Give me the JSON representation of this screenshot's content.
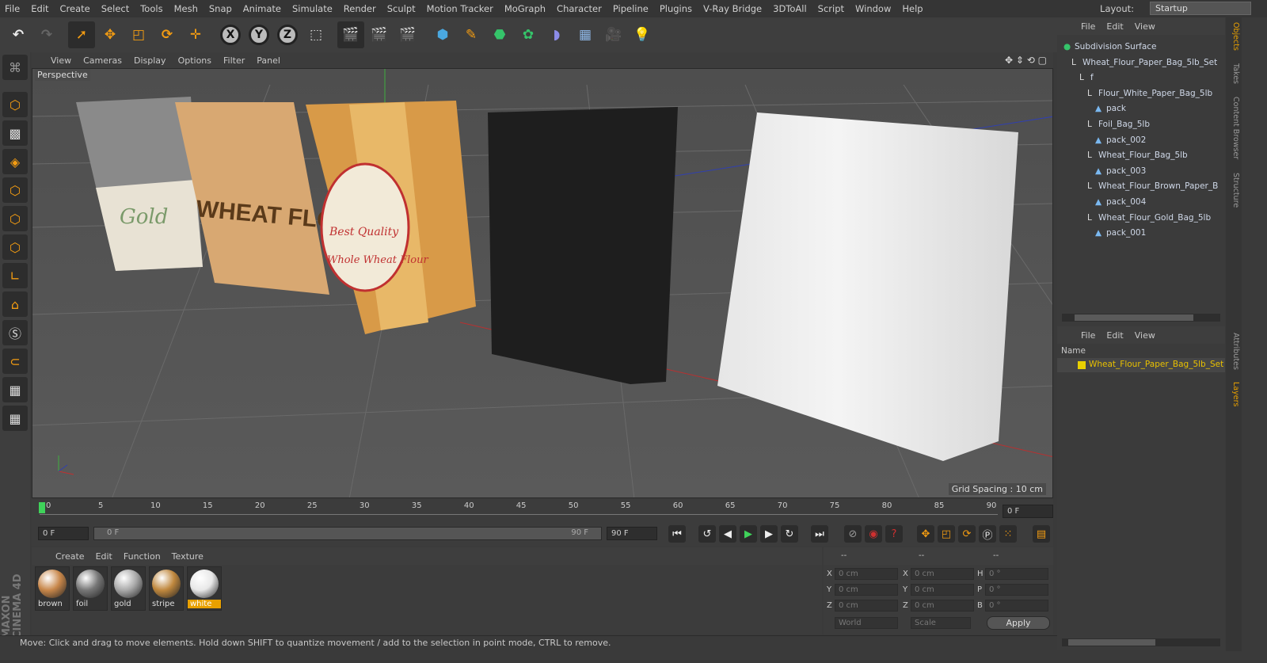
{
  "menubar": {
    "items": [
      "File",
      "Edit",
      "Create",
      "Select",
      "Tools",
      "Mesh",
      "Snap",
      "Animate",
      "Simulate",
      "Render",
      "Sculpt",
      "Motion Tracker",
      "MoGraph",
      "Character",
      "Pipeline",
      "Plugins",
      "V-Ray Bridge",
      "3DToAll",
      "Script",
      "Window",
      "Help"
    ],
    "layout_label": "Layout:",
    "layout_value": "Startup"
  },
  "toolbar": {
    "axis_x": "X",
    "axis_y": "Y",
    "axis_z": "Z"
  },
  "viewport": {
    "menu": [
      "View",
      "Cameras",
      "Display",
      "Options",
      "Filter",
      "Panel"
    ],
    "label": "Perspective",
    "grid_spacing": "Grid Spacing : 10 cm",
    "bag_texts": {
      "gold": "Gold",
      "wheat": "WHEAT FLOUR",
      "best": "Best Quality",
      "whole": "Whole Wheat Flour"
    }
  },
  "timeline": {
    "ticks": [
      "0",
      "5",
      "10",
      "15",
      "20",
      "25",
      "30",
      "35",
      "40",
      "45",
      "50",
      "55",
      "60",
      "65",
      "70",
      "75",
      "80",
      "85",
      "90"
    ],
    "current_frame": "0 F"
  },
  "transport": {
    "start_field": "0 F",
    "slider_start": "0 F",
    "slider_end": "90 F",
    "end_field": "90 F"
  },
  "material_manager": {
    "menu": [
      "Create",
      "Edit",
      "Function",
      "Texture"
    ],
    "materials": [
      {
        "name": "brown",
        "color": "#c8874a"
      },
      {
        "name": "foil",
        "color": "#777777"
      },
      {
        "name": "gold",
        "color": "#aaaaaa"
      },
      {
        "name": "stripe",
        "color": "#c0883e"
      },
      {
        "name": "white",
        "color": "#e8e8e8"
      }
    ],
    "selected": "white"
  },
  "attributes": {
    "header_left": "--",
    "header_mid": "--",
    "header_right": "--",
    "rows": [
      {
        "a": "X",
        "av": "0 cm",
        "b": "X",
        "bv": "0 cm",
        "c": "H",
        "cv": "0 °"
      },
      {
        "a": "Y",
        "av": "0 cm",
        "b": "Y",
        "bv": "0 cm",
        "c": "P",
        "cv": "0 °"
      },
      {
        "a": "Z",
        "av": "0 cm",
        "b": "Z",
        "bv": "0 cm",
        "c": "B",
        "cv": "0 °"
      }
    ],
    "coord_mode": "World",
    "scale_mode": "Scale",
    "apply": "Apply"
  },
  "status": "Move: Click and drag to move elements. Hold down SHIFT to quantize movement / add to the selection in point mode, CTRL to remove.",
  "object_manager": {
    "menu": [
      "File",
      "Edit",
      "View"
    ],
    "tree": [
      {
        "label": "Subdivision Surface",
        "depth": 0,
        "type": "subdiv"
      },
      {
        "label": "Wheat_Flour_Paper_Bag_5lb_Set",
        "depth": 1,
        "type": "null"
      },
      {
        "label": "f",
        "depth": 2,
        "type": "null"
      },
      {
        "label": "Flour_White_Paper_Bag_5lb",
        "depth": 3,
        "type": "null"
      },
      {
        "label": "pack",
        "depth": 4,
        "type": "mesh"
      },
      {
        "label": "Foil_Bag_5lb",
        "depth": 3,
        "type": "null"
      },
      {
        "label": "pack_002",
        "depth": 4,
        "type": "mesh"
      },
      {
        "label": "Wheat_Flour_Bag_5lb",
        "depth": 3,
        "type": "null"
      },
      {
        "label": "pack_003",
        "depth": 4,
        "type": "mesh"
      },
      {
        "label": "Wheat_Flour_Brown_Paper_B",
        "depth": 3,
        "type": "null"
      },
      {
        "label": "pack_004",
        "depth": 4,
        "type": "mesh"
      },
      {
        "label": "Wheat_Flour_Gold_Bag_5lb",
        "depth": 3,
        "type": "null"
      },
      {
        "label": "pack_001",
        "depth": 4,
        "type": "mesh"
      }
    ]
  },
  "layer_manager": {
    "menu": [
      "File",
      "Edit",
      "View"
    ],
    "column": "Name",
    "layer": "Wheat_Flour_Paper_Bag_5lb_Set",
    "layer_color": "#e8d000"
  },
  "side_tabs": [
    "Objects",
    "Takes",
    "Content Browser",
    "Structure",
    "Attributes",
    "Layers"
  ],
  "brand": "MAXON CINEMA 4D"
}
